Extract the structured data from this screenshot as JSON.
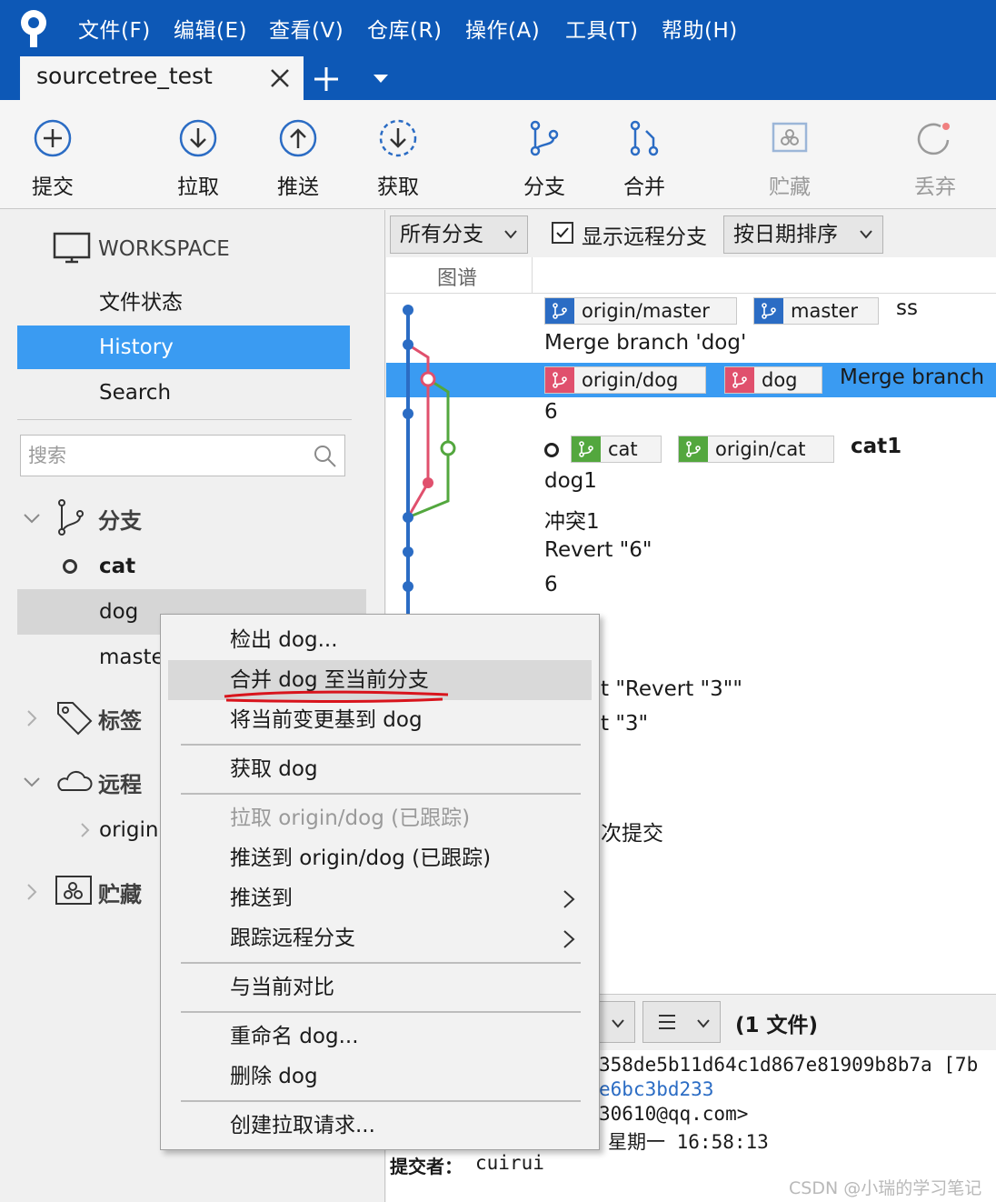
{
  "menubar": {
    "items": [
      "文件(F)",
      "编辑(E)",
      "查看(V)",
      "仓库(R)",
      "操作(A)",
      "工具(T)",
      "帮助(H)"
    ]
  },
  "tabs": {
    "repo_tab": "sourcetree_test"
  },
  "toolbar": {
    "commit": "提交",
    "pull": "拉取",
    "push": "推送",
    "fetch": "获取",
    "branch": "分支",
    "merge": "合并",
    "stash": "贮藏",
    "discard": "丢弃"
  },
  "sidebar": {
    "workspace_title": "WORKSPACE",
    "nav": [
      "文件状态",
      "History",
      "Search"
    ],
    "active_nav": "History",
    "search_placeholder": "搜索",
    "branches_label": "分支",
    "branches": [
      "cat",
      "dog",
      "maste"
    ],
    "current_branch": "cat",
    "tags_label": "标签",
    "remotes_label": "远程",
    "remote_item": "origin",
    "stash_label": "贮藏"
  },
  "main": {
    "branch_filter": "所有分支",
    "show_remote_label": "显示远程分支",
    "show_remote_checked": true,
    "sort_label": "按日期排序",
    "graph_column": "图谱",
    "commits": [
      {
        "refs": [
          {
            "name": "origin/master",
            "kind": "blue"
          },
          {
            "name": "master",
            "kind": "blue"
          }
        ],
        "message": "ss"
      },
      {
        "refs": [],
        "message": "Merge branch 'dog'"
      },
      {
        "refs": [
          {
            "name": "origin/dog",
            "kind": "red"
          },
          {
            "name": "dog",
            "kind": "red"
          }
        ],
        "message": "Merge branch"
      },
      {
        "refs": [],
        "message": "6"
      },
      {
        "refs": [
          {
            "name": "cat",
            "kind": "green"
          },
          {
            "name": "origin/cat",
            "kind": "green"
          }
        ],
        "message": "cat1"
      },
      {
        "refs": [],
        "message": "dog1"
      },
      {
        "refs": [],
        "message": "冲突1"
      },
      {
        "refs": [],
        "message": "Revert \"6\""
      },
      {
        "refs": [],
        "message": "6"
      },
      {
        "refs": [],
        "message": "t \"Revert \"3\"\""
      },
      {
        "refs": [],
        "message": "t \"3\""
      },
      {
        "refs": [],
        "message": "次提交"
      }
    ],
    "file_count": "(1 文件)",
    "detail_lines": [
      "358de5b11d64c1d867e81909b8b7a [7b",
      "e6bc3bd233",
      "30610@qq.com>",
      "星期一 16:58:13"
    ],
    "committer_label": "提交者：",
    "committer_value": "cuirui"
  },
  "context_menu": {
    "items": [
      {
        "label": "检出 dog...",
        "state": "normal"
      },
      {
        "label": "合并 dog 至当前分支",
        "state": "hover"
      },
      {
        "label": "将当前变更基到 dog",
        "state": "normal"
      },
      {
        "label": "获取 dog",
        "state": "normal"
      },
      {
        "label": "拉取 origin/dog (已跟踪)",
        "state": "disabled"
      },
      {
        "label": "推送到 origin/dog (已跟踪)",
        "state": "normal"
      },
      {
        "label": "推送到",
        "state": "submenu"
      },
      {
        "label": "跟踪远程分支",
        "state": "submenu"
      },
      {
        "label": "与当前对比",
        "state": "normal"
      },
      {
        "label": "重命名 dog...",
        "state": "normal"
      },
      {
        "label": "删除 dog",
        "state": "normal"
      },
      {
        "label": "创建拉取请求...",
        "state": "normal"
      }
    ]
  },
  "watermark": "CSDN @小瑞的学习笔记",
  "colors": {
    "titlebar": "#0d58b6",
    "selection": "#3a9bf2",
    "branch_blue": "#2b6cc4",
    "branch_red": "#e0506d",
    "branch_green": "#53a73e"
  }
}
